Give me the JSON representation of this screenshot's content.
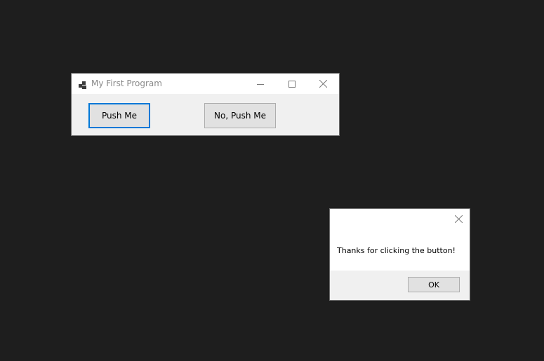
{
  "main_window": {
    "title": "My First Program",
    "icons": {
      "app": "app-icon",
      "minimize": "minimize-icon",
      "maximize": "maximize-icon",
      "close": "close-icon"
    },
    "buttons": {
      "push_me": "Push Me",
      "no_push_me": "No, Push Me"
    },
    "focused_button": "push_me",
    "colors": {
      "focus_border": "#0078d7",
      "title_text": "#8a8a8a"
    }
  },
  "message_box": {
    "text": "Thanks for clicking the button!",
    "ok_label": "OK",
    "icons": {
      "close": "close-icon"
    }
  },
  "desktop": {
    "background": "#1e1e1e"
  }
}
